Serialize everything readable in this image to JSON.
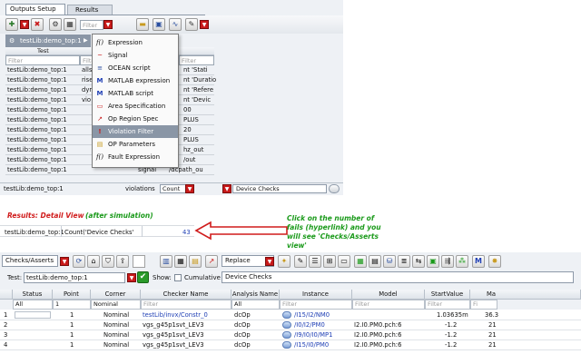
{
  "outputs": {
    "tabs": [
      "Outputs Setup",
      "Results"
    ],
    "filter_placeholder": "Filter",
    "selected_test": "testLib:demo_top:1",
    "column_test": "Test",
    "rows": [
      {
        "test": "testLib:demo_top:1",
        "name": "allst",
        "right": "nt 'Stati"
      },
      {
        "test": "testLib:demo_top:1",
        "name": "rise",
        "right": "nt 'Duratio"
      },
      {
        "test": "testLib:demo_top:1",
        "name": "dyn",
        "right": "nt 'Refere"
      },
      {
        "test": "testLib:demo_top:1",
        "name": "vio",
        "right": "nt 'Devic"
      },
      {
        "test": "testLib:demo_top:1",
        "name": "",
        "right": "00"
      },
      {
        "test": "testLib:demo_top:1",
        "name": "",
        "right": "PLUS"
      },
      {
        "test": "testLib:demo_top:1",
        "name": "",
        "right": "20"
      },
      {
        "test": "testLib:demo_top:1",
        "name": "",
        "right": "PLUS"
      },
      {
        "test": "testLib:demo_top:1",
        "name": "",
        "right": "hz_out"
      },
      {
        "test": "testLib:demo_top:1",
        "name": "",
        "right": "/out"
      },
      {
        "test": "testLib:demo_top:1",
        "name": "signal",
        "right": "/dcpath_ou"
      }
    ],
    "last_row": {
      "test": "testLib:demo_top:1",
      "name": "violations",
      "type": "Count",
      "details": "Device Checks"
    }
  },
  "menu": {
    "items": [
      {
        "icon": "f()",
        "label": "Expression"
      },
      {
        "icon": "~",
        "label": "Signal"
      },
      {
        "icon": "≡",
        "label": "OCEAN script"
      },
      {
        "icon": "M",
        "label": "MATLAB expression"
      },
      {
        "icon": "M",
        "label": "MATLAB script"
      },
      {
        "icon": "▭",
        "label": "Area Specification"
      },
      {
        "icon": "↗",
        "label": "Op Region Spec"
      },
      {
        "icon": "!",
        "label": "Violation Filter"
      },
      {
        "icon": "▤",
        "label": "OP Parameters"
      },
      {
        "icon": "f()",
        "label": "Fault Expression"
      }
    ]
  },
  "annotations": {
    "results_heading": "Results: Detail View",
    "results_note": "(after simulation)",
    "callout": "Click on the number of fails (hyperlink) and you will see 'Checks/Asserts view'"
  },
  "detail": {
    "test": "testLib:demo_top:1",
    "expression": "Count('Device Checks'",
    "fails": "43"
  },
  "checks": {
    "view_selector": "Checks/Asserts",
    "mode_selector": "Replace",
    "test_label": "Test:",
    "test_value": "testLib:demo_top:1",
    "show_label": "Show:",
    "cumulative_label": "Cumulative",
    "check_type": "Device Checks",
    "columns": [
      "Status",
      "Point",
      "Corner",
      "Checker Name",
      "Analysis Name",
      "Instance",
      "Model",
      "StartValue",
      "Ma"
    ],
    "filters": {
      "status": "All",
      "point": "1",
      "corner": "Nominal",
      "checker": "Filter",
      "analysis": "All",
      "instance": "Filter",
      "model": "Filter",
      "start": "Filter",
      "max": "Fi"
    },
    "rows": [
      {
        "num": "1",
        "point": "1",
        "corner": "Nominal",
        "checker": "testLib/invx/Constr_0",
        "analysis": "dcOp",
        "instance": "/I15/I2/NM0",
        "model": "",
        "start": "1.03635m",
        "max": "36.3"
      },
      {
        "num": "2",
        "point": "1",
        "corner": "Nominal",
        "checker": "vgs_g45p1svt_LEV3",
        "analysis": "dcOp",
        "instance": "/I0/I2/PM0",
        "model": "I2.I0.PM0.pch:6",
        "start": "-1.2",
        "max": "21"
      },
      {
        "num": "3",
        "point": "1",
        "corner": "Nominal",
        "checker": "vgs_g45p1svt_LEV3",
        "analysis": "dcOp",
        "instance": "/I9/I0/I0/MP1",
        "model": "I2.I0.PM0.pch:6",
        "start": "-1.2",
        "max": "21"
      },
      {
        "num": "4",
        "point": "1",
        "corner": "Nominal",
        "checker": "vgs_g45p1svt_LEV3",
        "analysis": "dcOp",
        "instance": "/I15/I0/PM0",
        "model": "I2.I0.PM0.pch:6",
        "start": "-1.2",
        "max": "21"
      }
    ]
  }
}
